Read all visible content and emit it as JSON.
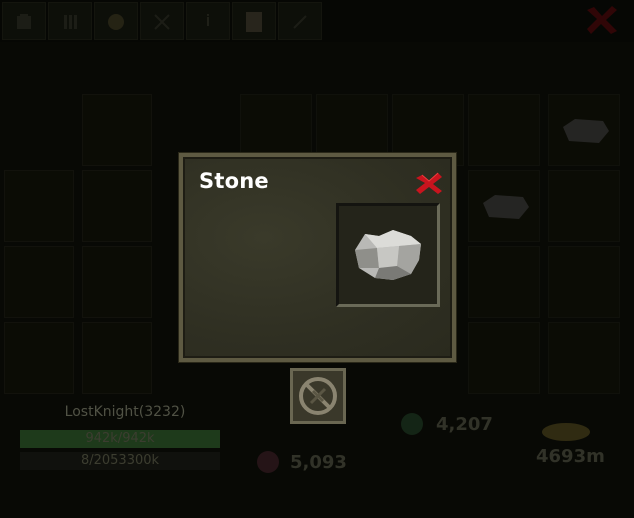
{
  "tabs": [
    {
      "icon": "inventory-icon"
    },
    {
      "icon": "equipment-icon"
    },
    {
      "icon": "shield-icon"
    },
    {
      "icon": "swords-icon"
    },
    {
      "icon": "info-icon",
      "glyph": "i"
    },
    {
      "icon": "quest-scroll-icon"
    },
    {
      "icon": "skills-icon"
    }
  ],
  "player": {
    "name": "LostKnight(3232)",
    "health": "942k/942k",
    "health_fraction": 1.0,
    "experience": "8/2053300k"
  },
  "stats": {
    "gems": "4,207",
    "tokens": "5,093",
    "gold": "4693m"
  },
  "popup": {
    "title": "Stone",
    "item_icon": "stone-icon"
  },
  "colors": {
    "popup_border": "#5e5a42",
    "close_red": "#c8141e",
    "title_text": "#ffffff",
    "health_green": "#2f5a2a"
  }
}
